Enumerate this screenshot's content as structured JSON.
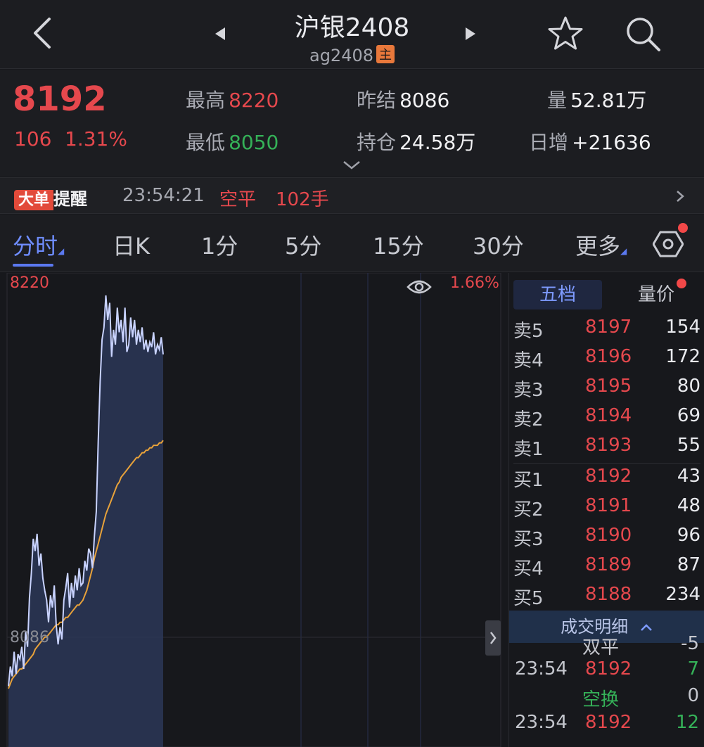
{
  "header": {
    "title": "沪银2408",
    "code": "ag2408",
    "badge": "主"
  },
  "quote": {
    "last_price": "8192",
    "change": "106",
    "change_pct": "1.31%",
    "high_label": "最高",
    "high": "8220",
    "low_label": "最低",
    "low": "8050",
    "prev_settle_label": "昨结",
    "prev_settle": "8086",
    "open_interest_label": "持仓",
    "open_interest": "24.58万",
    "volume_label": "量",
    "volume": "52.81万",
    "daily_increase_label": "日增",
    "daily_increase": "+21636"
  },
  "alert": {
    "badge": "大单",
    "title": "提醒",
    "time": "23:54:21",
    "action": "空平",
    "size": "102手"
  },
  "tabs": [
    {
      "label": "分时",
      "active": true
    },
    {
      "label": "日K",
      "active": false
    },
    {
      "label": "1分",
      "active": false
    },
    {
      "label": "5分",
      "active": false
    },
    {
      "label": "15分",
      "active": false
    },
    {
      "label": "30分",
      "active": false
    },
    {
      "label": "更多",
      "active": false
    }
  ],
  "chart_labels": {
    "top_price": "8220",
    "ref_price": "8086",
    "top_pct": "1.66%"
  },
  "chart_data": {
    "type": "line",
    "ylim": [
      8050,
      8220
    ],
    "series": [
      {
        "values": [
          8057,
          8065,
          8061,
          8071,
          8062,
          8070,
          8068,
          8073,
          8064,
          8079,
          8073,
          8093,
          8103,
          8117,
          8112,
          8119,
          8106,
          8111,
          8101,
          8096,
          8092,
          8083,
          8094,
          8089,
          8098,
          8082,
          8074,
          8081,
          8076,
          8092,
          8097,
          8103,
          8089,
          8099,
          8093,
          8102,
          8096,
          8105,
          8098,
          8099,
          8108,
          8104,
          8113,
          8111,
          8105,
          8118,
          8128,
          8157,
          8181,
          8198,
          8203,
          8216,
          8206,
          8213,
          8191,
          8202,
          8196,
          8211,
          8201,
          8206,
          8197,
          8211,
          8193,
          8196,
          8207,
          8199,
          8206,
          8196,
          8202,
          8197,
          8203,
          8194,
          8198,
          8193,
          8197,
          8195,
          8201,
          8192,
          8196,
          8194,
          8199,
          8192
        ]
      },
      {
        "values": [
          8056,
          8058,
          8060,
          8061,
          8062,
          8063,
          8064,
          8064,
          8065,
          8066,
          8067,
          8068,
          8069,
          8070,
          8072,
          8073,
          8074,
          8075,
          8076,
          8077,
          8077,
          8078,
          8079,
          8080,
          8081,
          8082,
          8082,
          8083,
          8083,
          8084,
          8085,
          8085,
          8086,
          8087,
          8088,
          8089,
          8090,
          8090,
          8091,
          8092,
          8094,
          8096,
          8099,
          8102,
          8105,
          8109,
          8112,
          8115,
          8118,
          8121,
          8124,
          8127,
          8129,
          8131,
          8133,
          8135,
          8137,
          8139,
          8140,
          8142,
          8143,
          8144,
          8145,
          8146,
          8147,
          8148,
          8149,
          8150,
          8150,
          8151,
          8152,
          8152,
          8153,
          8153,
          8154,
          8154,
          8155,
          8155,
          8155,
          8156,
          8156,
          8157
        ]
      }
    ]
  },
  "order_book": {
    "tab_active": "五档",
    "tab_other": "量价",
    "rows": [
      {
        "label": "卖5",
        "price": "8197",
        "volume": "154"
      },
      {
        "label": "卖4",
        "price": "8196",
        "volume": "172"
      },
      {
        "label": "卖3",
        "price": "8195",
        "volume": "80"
      },
      {
        "label": "卖2",
        "price": "8194",
        "volume": "69"
      },
      {
        "label": "卖1",
        "price": "8193",
        "volume": "55"
      },
      {
        "label": "买1",
        "price": "8192",
        "volume": "43"
      },
      {
        "label": "买2",
        "price": "8191",
        "volume": "48"
      },
      {
        "label": "买3",
        "price": "8190",
        "volume": "96"
      },
      {
        "label": "买4",
        "price": "8189",
        "volume": "87"
      },
      {
        "label": "买5",
        "price": "8188",
        "volume": "234"
      }
    ],
    "deal_detail_label": "成交明细",
    "trades": [
      {
        "time": "",
        "price": "",
        "type": "双平",
        "volume": "-5"
      },
      {
        "time": "23:54",
        "price": "8192",
        "type": "",
        "volume": "7"
      },
      {
        "time": "",
        "price": "",
        "type": "空换",
        "volume": "0"
      },
      {
        "time": "23:54",
        "price": "8192",
        "type": "",
        "volume": "12"
      }
    ]
  },
  "colors": {
    "up": "#e5484d",
    "down": "#35b158",
    "accent": "#5b79f0",
    "price_line": "#c9d3ff",
    "avg_line": "#e8a23a",
    "fill": "#2b3757"
  }
}
